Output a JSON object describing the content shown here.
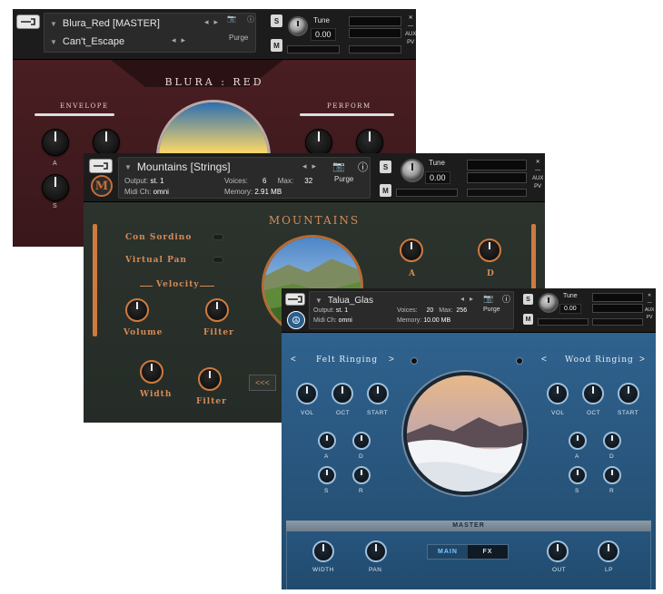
{
  "blura": {
    "header": {
      "instrument_name": "Blura_Red [MASTER]",
      "snapshot_name": "Can't_Escape",
      "purge_label": "Purge",
      "tune_label": "Tune",
      "tune_value": "0.00",
      "aux_label": "AUX",
      "pv_label": "PV"
    },
    "title": "BLURA : RED",
    "sections": {
      "envelope": "ENVELOPE",
      "perform": "PERFORM"
    },
    "knob_labels": [
      "A",
      "S"
    ]
  },
  "mountains": {
    "header": {
      "instrument_name": "Mountains [Strings]",
      "output_label": "Output:",
      "output_value": "st. 1",
      "voices_label": "Voices:",
      "voices_value": "6",
      "max_label": "Max:",
      "max_value": "32",
      "purge_label": "Purge",
      "midi_label": "Midi Ch:",
      "midi_value": "omni",
      "memory_label": "Memory:",
      "memory_value": "2.91 MB",
      "tune_label": "Tune",
      "tune_value": "0.00",
      "solo_label": "S",
      "mute_label": "M",
      "aux_label": "AUX",
      "pv_label": "PV",
      "logo_letter": "M"
    },
    "title": "MOUNTAINS",
    "con_sordino": "Con Sordino",
    "virtual_pan": "Virtual Pan",
    "velocity": "Velocity",
    "volume": "Volume",
    "filter": "Filter",
    "width": "Width",
    "filter2": "Filter",
    "attack": "A",
    "decay": "D",
    "nav_prev": "<<<"
  },
  "talua": {
    "header": {
      "instrument_name": "Talua_Glas",
      "output_label": "Output:",
      "output_value": "st. 1",
      "voices_label": "Voices:",
      "voices_value": "20",
      "max_label": "Max:",
      "max_value": "256",
      "purge_label": "Purge",
      "midi_label": "Midi Ch:",
      "midi_value": "omni",
      "memory_label": "Memory:",
      "memory_value": "10.00 MB",
      "tune_label": "Tune",
      "tune_value": "0.00",
      "solo_label": "S",
      "mute_label": "M",
      "aux_label": "AUX",
      "pv_label": "PV"
    },
    "left_layer": {
      "name": "Felt Ringing",
      "vol": "VOL",
      "oct": "OCT",
      "start": "START",
      "a": "A",
      "d": "D",
      "s": "S",
      "r": "R"
    },
    "right_layer": {
      "name": "Wood Ringing",
      "vol": "VOL",
      "oct": "OCT",
      "start": "START",
      "a": "A",
      "d": "D",
      "s": "S",
      "r": "R"
    },
    "master": {
      "title": "MASTER",
      "width": "WIDTH",
      "pan": "PAN",
      "out": "OUT",
      "lp": "LP",
      "tab_main": "MAIN",
      "tab_fx": "FX"
    }
  },
  "colors": {
    "blura_bg": "#3f1a1e",
    "mountains_bg": "#252c27",
    "mountains_accent": "#cf7a3f",
    "talua_bg": "#28557c",
    "talua_accent": "#7ec6ff"
  }
}
